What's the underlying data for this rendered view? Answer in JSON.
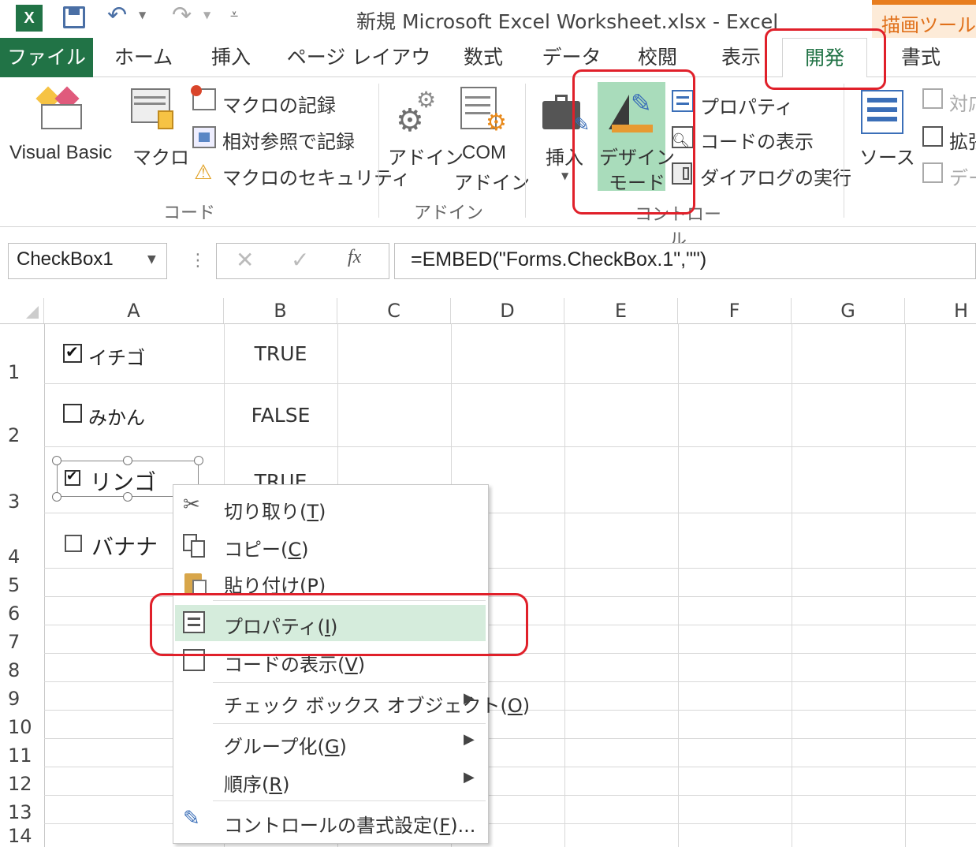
{
  "titlebar": {
    "title": "新規 Microsoft Excel Worksheet.xlsx - Excel",
    "tool_context": "描画ツール"
  },
  "tabs": [
    "ファイル",
    "ホーム",
    "挿入",
    "ページ レイアウト",
    "数式",
    "データ",
    "校閲",
    "表示",
    "開発",
    "書式"
  ],
  "ribbon": {
    "code_group": {
      "label": "コード",
      "visual_basic": "Visual Basic",
      "macro": "マクロ",
      "record_macro": "マクロの記録",
      "relative_ref": "相対参照で記録",
      "macro_security": "マクロのセキュリティ"
    },
    "addin_group": {
      "label": "アドイン",
      "addin": "アドイン",
      "com_line1": "COM",
      "com_line2": "アドイン"
    },
    "control_group": {
      "label": "コントロール",
      "insert": "挿入",
      "design_mode_line1": "デザイン",
      "design_mode_line2": "モード",
      "properties": "プロパティ",
      "view_code": "コードの表示",
      "run_dialog": "ダイアログの実行"
    },
    "xml_group": {
      "source": "ソース",
      "map_props": "対応",
      "expansion": "拡張",
      "data": "デー"
    }
  },
  "formula_bar": {
    "name_box": "CheckBox1",
    "fx": "fx",
    "formula": "=EMBED(\"Forms.CheckBox.1\",\"\")"
  },
  "columns": [
    "A",
    "B",
    "C",
    "D",
    "E",
    "F",
    "G",
    "H"
  ],
  "rows": [
    "1",
    "2",
    "3",
    "4",
    "5",
    "6",
    "7",
    "8",
    "9",
    "10",
    "11",
    "12",
    "13",
    "14"
  ],
  "checkboxes": [
    {
      "label": "イチゴ",
      "checked": true
    },
    {
      "label": "みかん",
      "checked": false
    },
    {
      "label": "リンゴ",
      "checked": true
    },
    {
      "label": "バナナ",
      "checked": false
    }
  ],
  "column_b": [
    "TRUE",
    "FALSE",
    "TRUE"
  ],
  "context_menu": {
    "cut": {
      "text": "切り取り(",
      "key": "T",
      "end": ")"
    },
    "copy": {
      "text": "コピー(",
      "key": "C",
      "end": ")"
    },
    "paste": {
      "text": "貼り付け(",
      "key": "P",
      "end": ")"
    },
    "properties": {
      "text": "プロパティ(",
      "key": "I",
      "end": ")"
    },
    "view_code": {
      "text": "コードの表示(",
      "key": "V",
      "end": ")"
    },
    "checkbox_object": {
      "text": "チェック ボックス オブジェクト(",
      "key": "O",
      "end": ")"
    },
    "group": {
      "text": "グループ化(",
      "key": "G",
      "end": ")"
    },
    "order": {
      "text": "順序(",
      "key": "R",
      "end": ")"
    },
    "format_control": {
      "text": "コントロールの書式設定(",
      "key": "F",
      "end": ")..."
    }
  },
  "colors": {
    "excel_green": "#217346",
    "highlight_green": "#a9dcbb",
    "menu_highlight": "#d5ecdc",
    "annotation_red": "#e0202a",
    "tool_orange": "#e87d1e"
  }
}
